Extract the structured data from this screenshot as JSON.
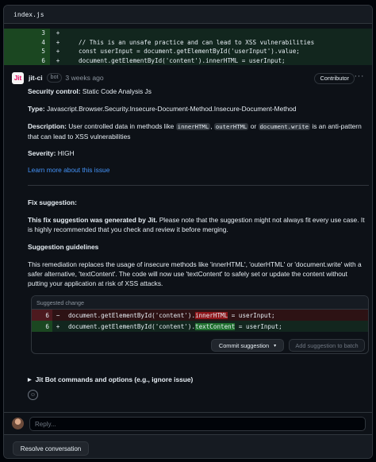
{
  "file": {
    "name": "index.js"
  },
  "diff_lines": [
    {
      "num": "3",
      "sign": "+",
      "code": ""
    },
    {
      "num": "4",
      "sign": "+",
      "code": "// This is an unsafe practice and can lead to XSS vulnerabilities"
    },
    {
      "num": "5",
      "sign": "+",
      "code": "const userInput = document.getElementById('userInput').value;"
    },
    {
      "num": "6",
      "sign": "+",
      "code": "document.getElementById('content').innerHTML = userInput;"
    }
  ],
  "comment": {
    "author": "jit-ci",
    "avatar_text": "Jit",
    "bot_label": "bot",
    "time": "3 weeks ago",
    "role_badge": "Contributor",
    "menu": "···",
    "control_label": "Security control:",
    "control_value": "Static Code Analysis Js",
    "type_label": "Type:",
    "type_value": "Javascript.Browser.Security.Insecure-Document-Method.Insecure-Document-Method",
    "desc_label": "Description:",
    "desc_text_1": "User controlled data in methods like",
    "desc_code_1": "innerHTML",
    "desc_sep_1": ",",
    "desc_code_2": "outerHTML",
    "desc_sep_2": "or",
    "desc_code_3": "document.write",
    "desc_text_2": "is an anti-pattern",
    "desc_text_3": "that can lead to XSS vulnerabilities",
    "severity_label": "Severity:",
    "severity_value": "HIGH",
    "learn_more": "Learn more about this issue",
    "fix_heading": "Fix suggestion:",
    "fix_bold": "This fix suggestion was generated by Jit.",
    "fix_text_1": "Please note that the suggestion might not always fit every use case. It",
    "fix_text_2": "is highly recommended that you check and review it before merging.",
    "guidelines_heading": "Suggestion guidelines",
    "guide_1": "This remediation replaces the usage of insecure methods like 'innerHTML', 'outerHTML' or 'document.write' with a",
    "guide_2": "safer alternative, 'textContent'. The code will now use 'textContent' to safely set or update the content without",
    "guide_3": "putting your application at risk of XSS attacks."
  },
  "suggestion": {
    "header": "Suggested change",
    "del": {
      "num": "6",
      "sign": "−",
      "pre": "document.getElementById('content').",
      "hl": "innerHTML",
      "post": " = userInput;"
    },
    "add": {
      "num": "6",
      "sign": "+",
      "pre": "document.getElementById('content').",
      "hl": "textContent",
      "post": " = userInput;"
    },
    "commit_button": "Commit suggestion",
    "batch_button": "Add suggestion to batch"
  },
  "details_summary": "Jit Bot commands and options (e.g., ignore issue)",
  "reply_placeholder": "Reply...",
  "resolve_button": "Resolve conversation"
}
